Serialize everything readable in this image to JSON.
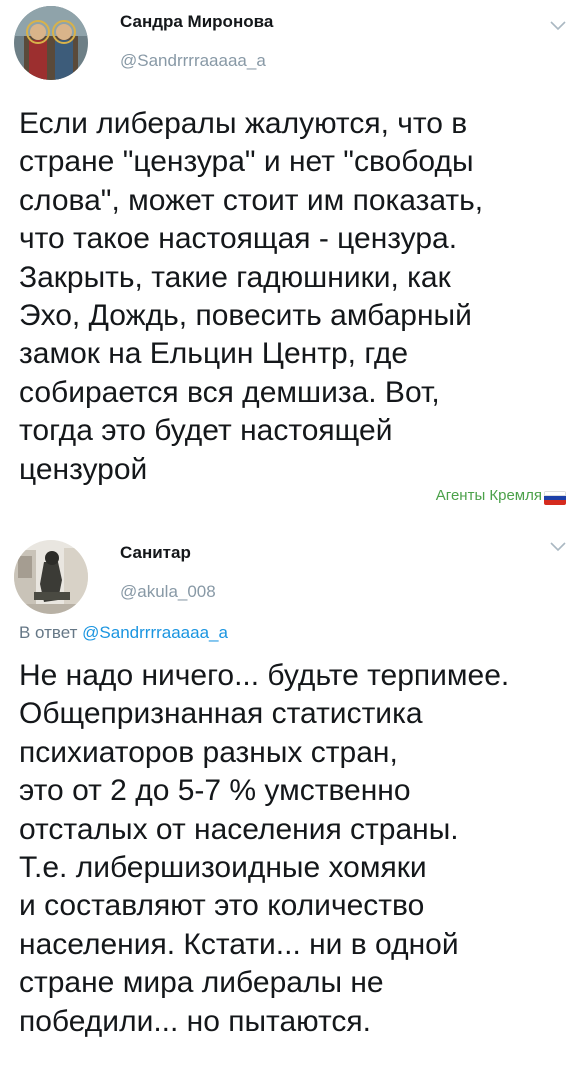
{
  "tweets": [
    {
      "author_name": "Сандра Миронова",
      "author_handle": "@Sandrrrraaaaa_a",
      "avatar_icon": "avatar-icon",
      "menu_icon": "chevron-down-icon",
      "text": "Если либералы жалуются, что в\nстране \"цензура\" и нет \"свободы\nслова\", может стоит им показать,\nчто такое настоящая - цензура.\nЗакрыть, такие гадюшники, как\nЭхо, Дождь, повесить амбарный\nзамок на Ельцин Центр, где\nсобирается вся демшиза. Вот,\nтогда это будет настоящей\nцензурой"
    },
    {
      "author_name": "Санитар",
      "author_handle": "@akula_008",
      "avatar_icon": "avatar-icon",
      "menu_icon": "chevron-down-icon",
      "reply_prefix": "В ответ ",
      "reply_handle": "@Sandrrrraaaaa_a",
      "text": "Не надо ничего... будьте терпимее.\nОбщепризнанная статистика\nпсихиаторов разных стран,\nэто от 2 до 5-7 % умственно\nотсталых от населения страны.\nТ.е. либершизоидные хомяки\nи составляют это количество\nнаселения. Кстати... ни в одной\nстране мира либералы не\nпобедили... но пытаются."
    }
  ],
  "watermark": {
    "label": "Агенты Кремля",
    "icon": "russian-flag-icon",
    "color": "#4ba14a"
  },
  "colors": {
    "text": "#14171a",
    "secondary": "#8899a6",
    "link": "#1b95e0"
  }
}
